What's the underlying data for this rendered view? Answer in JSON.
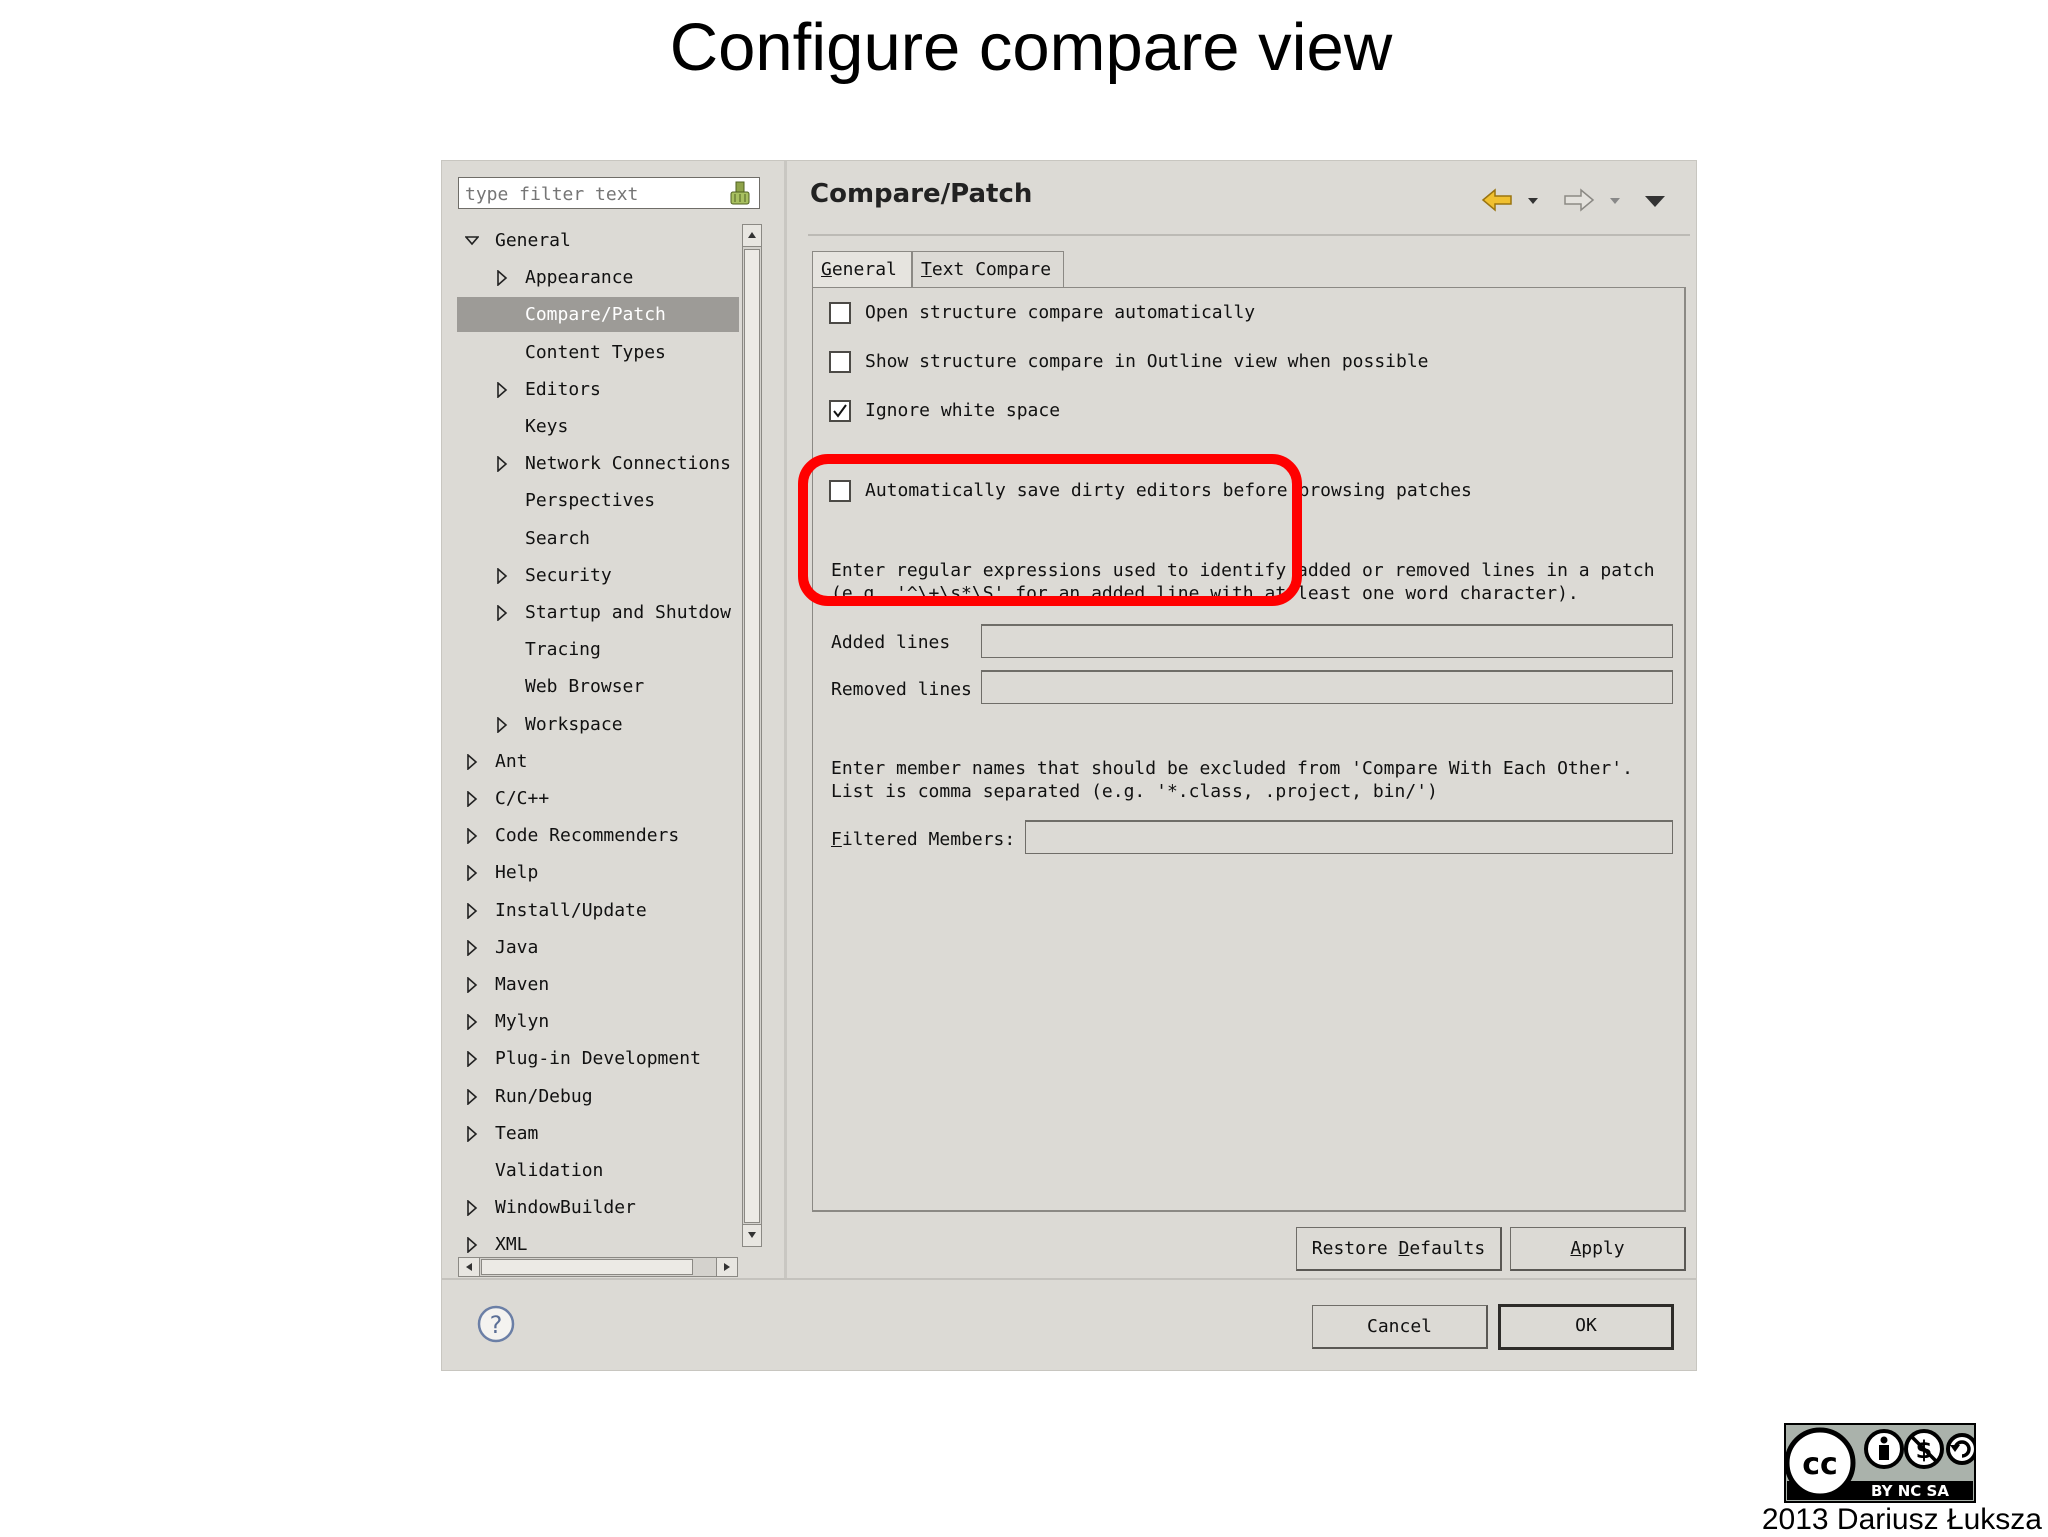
{
  "slide": {
    "title": "Configure compare view",
    "credit": "2013 Dariusz Łuksza",
    "badge_text": "BY  NC  SA"
  },
  "filter": {
    "placeholder": "type filter text"
  },
  "tree": {
    "items": [
      {
        "label": "General",
        "level": 0,
        "expander": "expanded"
      },
      {
        "label": "Appearance",
        "level": 1,
        "expander": "collapsed"
      },
      {
        "label": "Compare/Patch",
        "level": 1,
        "expander": "none",
        "selected": true
      },
      {
        "label": "Content Types",
        "level": 1,
        "expander": "none"
      },
      {
        "label": "Editors",
        "level": 1,
        "expander": "collapsed"
      },
      {
        "label": "Keys",
        "level": 1,
        "expander": "none"
      },
      {
        "label": "Network Connections",
        "level": 1,
        "expander": "collapsed"
      },
      {
        "label": "Perspectives",
        "level": 1,
        "expander": "none"
      },
      {
        "label": "Search",
        "level": 1,
        "expander": "none"
      },
      {
        "label": "Security",
        "level": 1,
        "expander": "collapsed"
      },
      {
        "label": "Startup and Shutdow",
        "level": 1,
        "expander": "collapsed"
      },
      {
        "label": "Tracing",
        "level": 1,
        "expander": "none"
      },
      {
        "label": "Web Browser",
        "level": 1,
        "expander": "none"
      },
      {
        "label": "Workspace",
        "level": 1,
        "expander": "collapsed"
      },
      {
        "label": "Ant",
        "level": 0,
        "expander": "collapsed"
      },
      {
        "label": "C/C++",
        "level": 0,
        "expander": "collapsed"
      },
      {
        "label": "Code Recommenders",
        "level": 0,
        "expander": "collapsed"
      },
      {
        "label": "Help",
        "level": 0,
        "expander": "collapsed"
      },
      {
        "label": "Install/Update",
        "level": 0,
        "expander": "collapsed"
      },
      {
        "label": "Java",
        "level": 0,
        "expander": "collapsed"
      },
      {
        "label": "Maven",
        "level": 0,
        "expander": "collapsed"
      },
      {
        "label": "Mylyn",
        "level": 0,
        "expander": "collapsed"
      },
      {
        "label": "Plug-in Development",
        "level": 0,
        "expander": "collapsed"
      },
      {
        "label": "Run/Debug",
        "level": 0,
        "expander": "collapsed"
      },
      {
        "label": "Team",
        "level": 0,
        "expander": "collapsed"
      },
      {
        "label": "Validation",
        "level": 0,
        "expander": "none"
      },
      {
        "label": "WindowBuilder",
        "level": 0,
        "expander": "collapsed"
      },
      {
        "label": "XML",
        "level": 0,
        "expander": "collapsed"
      }
    ]
  },
  "page": {
    "title": "Compare/Patch",
    "tabs": [
      {
        "label": "General",
        "mnemonic": "G",
        "active": true
      },
      {
        "label": "Text Compare",
        "mnemonic": "T",
        "active": false
      }
    ],
    "options": [
      {
        "label": "Open structure compare automatically",
        "checked": false
      },
      {
        "label": "Show structure compare in Outline view when possible",
        "checked": false
      },
      {
        "label": "Ignore white space",
        "checked": true
      },
      {
        "label": "Automatically save dirty editors before browsing patches",
        "checked": false
      }
    ],
    "regex_help": [
      "Enter regular expressions used to identify added or removed lines in a patch",
      "(e.g. '^\\+\\s*\\S' for an added line with at least one word character)."
    ],
    "added_label": "Added lines",
    "added_value": "",
    "removed_label": "Removed lines",
    "removed_value": "",
    "members_help": [
      "Enter member names that should be excluded from 'Compare With Each Other'.",
      "List is comma separated (e.g. '*.class, .project, bin/')"
    ],
    "filtered_label": "Filtered Members:",
    "filtered_value": ""
  },
  "buttons": {
    "restore_defaults": "Restore Defaults",
    "apply": "Apply",
    "cancel": "Cancel",
    "ok": "OK"
  },
  "colors": {
    "dialog_bg": "#dcdad5",
    "highlight": "#ff0000",
    "selection": "#9d9b97",
    "nav_arrow": "#e8b020"
  }
}
